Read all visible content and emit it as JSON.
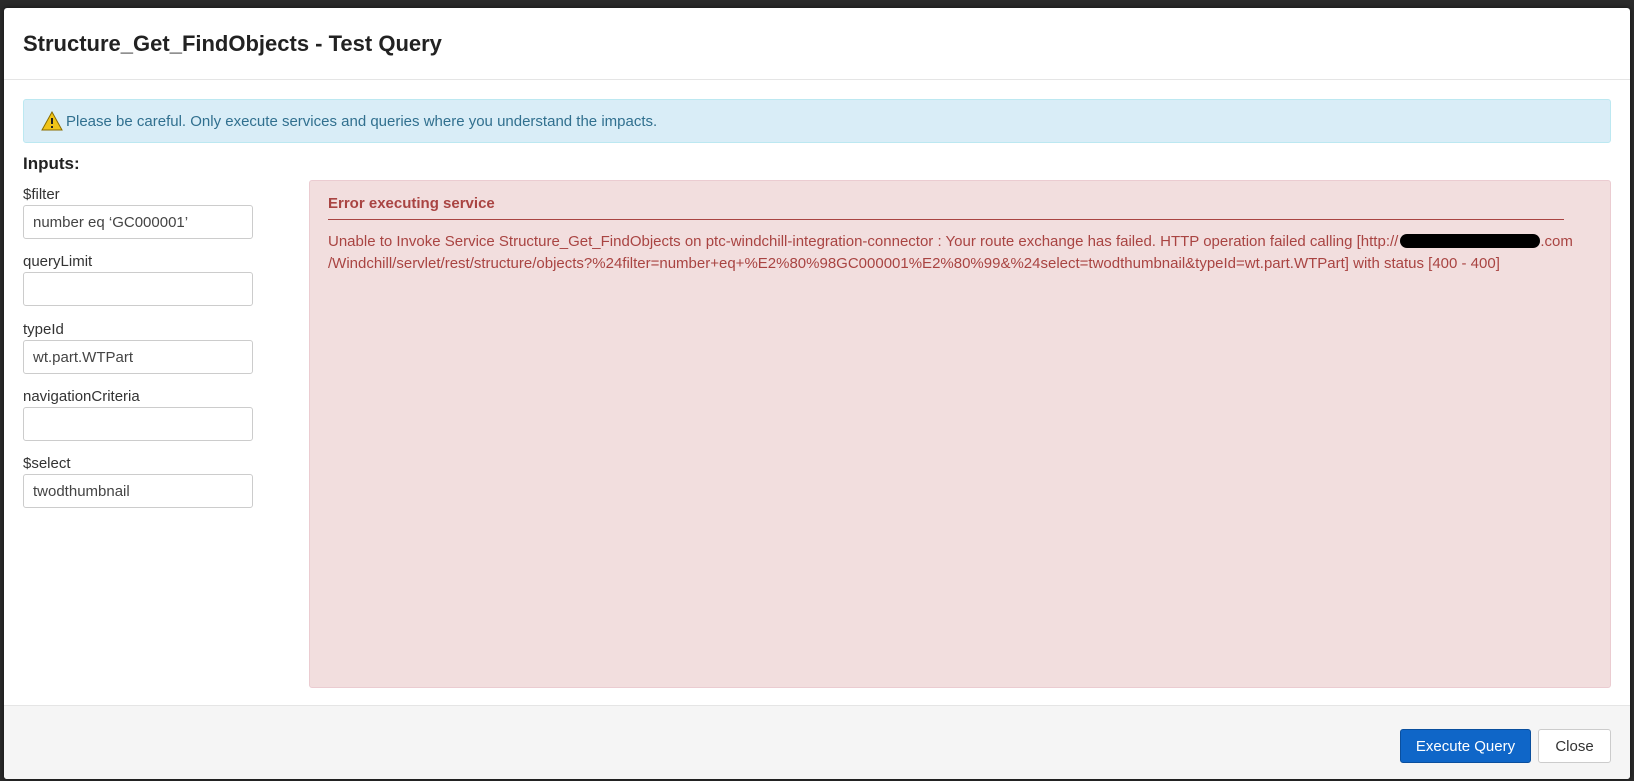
{
  "dialog": {
    "title": "Structure_Get_FindObjects - Test Query"
  },
  "alert": {
    "icon": "warning-icon",
    "text": "Please be careful. Only execute services and queries where you understand the impacts."
  },
  "inputs": {
    "title": "Inputs:",
    "fields": [
      {
        "label": "$filter",
        "value": "number eq ‘GC000001’",
        "placeholder": ""
      },
      {
        "label": "queryLimit",
        "value": "",
        "placeholder": ""
      },
      {
        "label": "typeId",
        "value": "wt.part.WTPart",
        "placeholder": ""
      },
      {
        "label": "navigationCriteria",
        "value": "",
        "placeholder": ""
      },
      {
        "label": "$select",
        "value": "twodthumbnail",
        "placeholder": ""
      }
    ]
  },
  "error": {
    "title": "Error executing service",
    "message_part1": "Unable to Invoke Service Structure_Get_FindObjects on ptc-windchill-integration-connector : Your route exchange has failed. HTTP operation failed calling [http://",
    "message_part2": ".com",
    "message_part3": "/Windchill/servlet/rest/structure/objects?%24filter=number+eq+%E2%80%98GC000001%E2%80%99&%24select=twodthumbnail&typeId=wt.part.WTPart] with status [400 - 400]"
  },
  "footer": {
    "execute_label": "Execute Query",
    "close_label": "Close"
  },
  "colors": {
    "primary": "#0f66c8",
    "error_text": "#a94442",
    "error_bg": "#f2dede",
    "info_bg": "#d9edf7",
    "info_text": "#31708f"
  }
}
